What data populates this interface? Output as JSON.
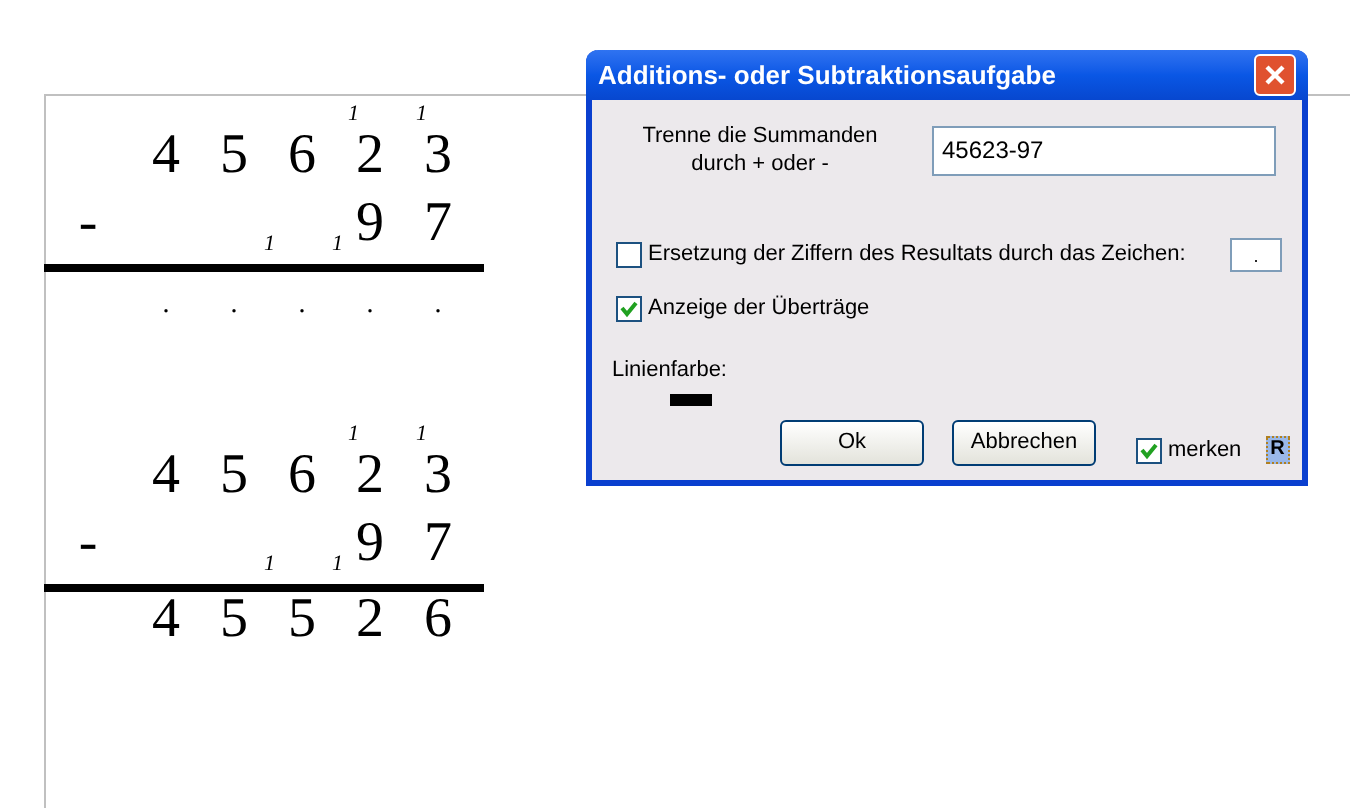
{
  "worksheet": {
    "problems": [
      {
        "operator": "-",
        "top": [
          {
            "digit": "4"
          },
          {
            "digit": "5"
          },
          {
            "digit": "6"
          },
          {
            "digit": "2",
            "carry": "1"
          },
          {
            "digit": "3",
            "carry": "1"
          }
        ],
        "bottom": [
          {
            "carry": "1"
          },
          {
            "digit": "9",
            "carry": "1"
          },
          {
            "digit": "7"
          }
        ],
        "result": [
          {
            "text": ".",
            "kind": "placeholder"
          },
          {
            "text": ".",
            "kind": "placeholder"
          },
          {
            "text": ".",
            "kind": "placeholder"
          },
          {
            "text": ".",
            "kind": "placeholder"
          },
          {
            "text": ".",
            "kind": "placeholder"
          }
        ]
      },
      {
        "operator": "-",
        "top": [
          {
            "digit": "4"
          },
          {
            "digit": "5"
          },
          {
            "digit": "6"
          },
          {
            "digit": "2",
            "carry": "1"
          },
          {
            "digit": "3",
            "carry": "1"
          }
        ],
        "bottom": [
          {
            "carry": "1"
          },
          {
            "digit": "9",
            "carry": "1"
          },
          {
            "digit": "7"
          }
        ],
        "result": [
          {
            "text": "4",
            "kind": "digit"
          },
          {
            "text": "5",
            "kind": "digit"
          },
          {
            "text": "5",
            "kind": "digit"
          },
          {
            "text": "2",
            "kind": "digit"
          },
          {
            "text": "6",
            "kind": "digit"
          }
        ]
      }
    ]
  },
  "dialog": {
    "title": "Additions- oder Subtraktionsaufgabe",
    "summands_label": "Trenne die Summanden durch + oder -",
    "summands_value": "45623-97",
    "replace": {
      "label": "Ersetzung der Ziffern des Resultats durch das Zeichen:",
      "checked": false,
      "char": "."
    },
    "carries": {
      "label": "Anzeige der Überträge",
      "checked": true
    },
    "line_color": {
      "label": "Linienfarbe:",
      "color": "#000000"
    },
    "buttons": [
      "Ok",
      "Abbrechen"
    ],
    "remember": {
      "label": "merken",
      "checked": true
    },
    "r_button": "R"
  }
}
